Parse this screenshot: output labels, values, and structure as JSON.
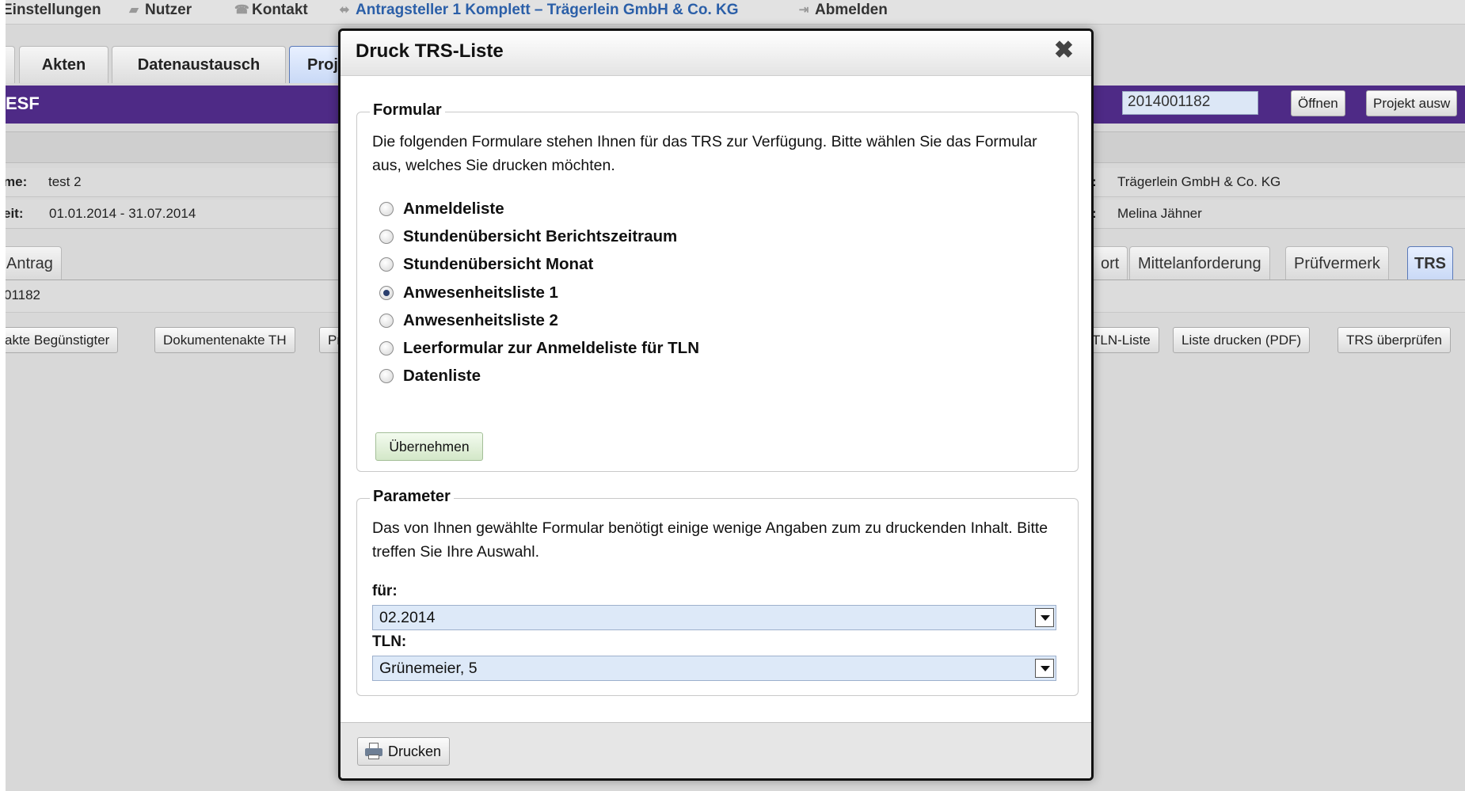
{
  "topbar": {
    "settings": "Einstellungen",
    "users": "Nutzer",
    "contact": "Kontakt",
    "applicant": "Antragsteller 1 Komplett – Trägerlein GmbH & Co. KG",
    "logout": "Abmelden"
  },
  "main_tabs": [
    "Akten",
    "Datenaustausch",
    "Proj"
  ],
  "project_bar": {
    "title": "ESF",
    "project_number": "2014001182",
    "open_label": "Öffnen",
    "select_label": "Projekt ausw"
  },
  "info": {
    "name_key": "me:",
    "name_value": "test 2",
    "period_key": "eit:",
    "period_value": "01.01.2014 - 31.07.2014",
    "org_key": ":",
    "org_value": "Trägerlein GmbH & Co. KG",
    "contact_key": ":",
    "contact_value": "Melina Jähner"
  },
  "sub_tabs": {
    "antrag": "Antrag",
    "bericht": "ort",
    "mittelanforderung": "Mittelanforderung",
    "pruefvermerk": "Prüfvermerk",
    "trs": "TRS"
  },
  "id_row": "01182",
  "action_buttons": {
    "begunstigter": "akte Begünstigter",
    "dokumentenakte": "Dokumentenakte TH",
    "pr": "Pr",
    "tln_liste": "TLN-Liste",
    "liste_drucken": "Liste drucken (PDF)",
    "trs_pruefen": "TRS überprüfen"
  },
  "dialog": {
    "title": "Druck TRS-Liste",
    "close_glyph": "✖",
    "formular": {
      "legend": "Formular",
      "description": "Die folgenden Formulare stehen Ihnen für das TRS zur Verfügung. Bitte wählen Sie das Formular aus, welches Sie drucken möchten.",
      "options": [
        "Anmeldeliste",
        "Stundenübersicht Berichtszeitraum",
        "Stundenübersicht Monat",
        "Anwesenheitsliste 1",
        "Anwesenheitsliste 2",
        "Leerformular zur Anmeldeliste für TLN",
        "Datenliste"
      ],
      "selected_index": 3,
      "apply_label": "Übernehmen"
    },
    "parameter": {
      "legend": "Parameter",
      "description": "Das von Ihnen gewählte Formular benötigt einige wenige Angaben zum zu druckenden Inhalt. Bitte treffen Sie Ihre Auswahl.",
      "fuer_label": "für:",
      "fuer_value": "02.2014",
      "tln_label": "TLN:",
      "tln_value": "Grünemeier, 5"
    },
    "print_label": "Drucken"
  },
  "colors": {
    "project_bar": "#4e2a86",
    "select_bg": "#dde9f8",
    "apply_bg": "#d3e7c8"
  }
}
